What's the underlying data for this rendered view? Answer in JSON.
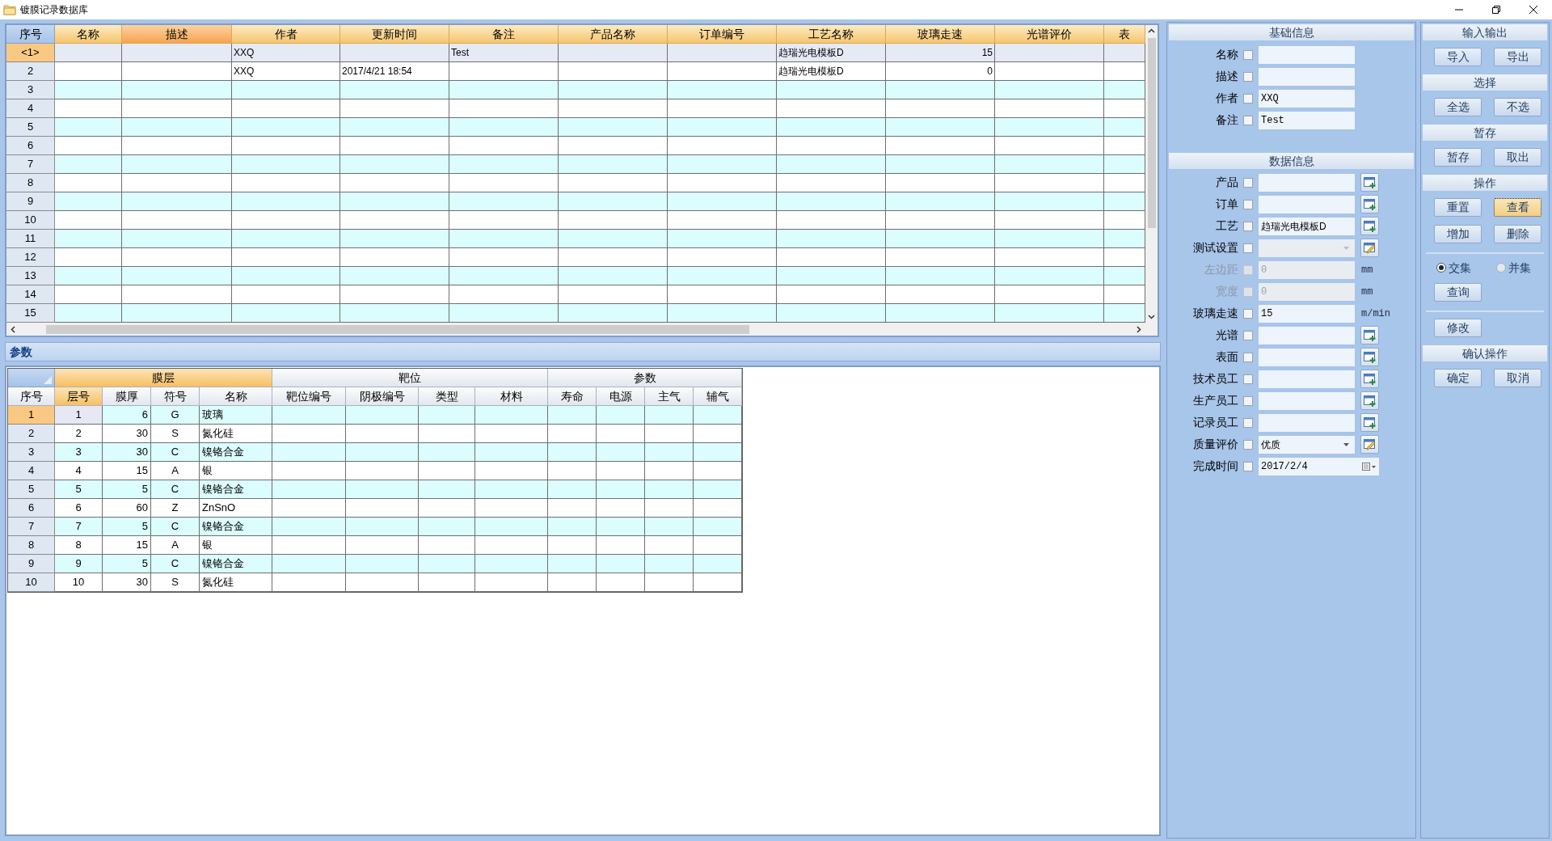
{
  "window": {
    "title": "镀膜记录数据库"
  },
  "top_table": {
    "index_label": "序号",
    "columns": [
      {
        "label": "名称",
        "selected": false,
        "kind": "text"
      },
      {
        "label": "描述",
        "selected": true,
        "kind": "text"
      },
      {
        "label": "作者",
        "selected": false,
        "kind": "text"
      },
      {
        "label": "更新时间",
        "selected": false,
        "kind": "text"
      },
      {
        "label": "备注",
        "selected": false,
        "kind": "text"
      },
      {
        "label": "产品名称",
        "selected": false,
        "kind": "text"
      },
      {
        "label": "订单编号",
        "selected": false,
        "kind": "text"
      },
      {
        "label": "工艺名称",
        "selected": false,
        "kind": "text"
      },
      {
        "label": "玻璃走速",
        "selected": false,
        "kind": "number"
      },
      {
        "label": "光谱评价",
        "selected": false,
        "kind": "text"
      },
      {
        "label": "表",
        "selected": false,
        "kind": "text"
      }
    ],
    "rows": [
      {
        "no": "<1>",
        "selected": true,
        "author": "XXQ",
        "remark": "Test",
        "process_name": "趋瑞光电模板D",
        "glass_speed": "15"
      },
      {
        "no": "2",
        "selected": false,
        "author": "XXQ",
        "updated": "2017/4/21 18:54",
        "process_name": "趋瑞光电模板D",
        "glass_speed": "0"
      },
      {
        "no": "3",
        "selected": false
      },
      {
        "no": "4",
        "selected": false
      },
      {
        "no": "5",
        "selected": false
      },
      {
        "no": "6",
        "selected": false
      },
      {
        "no": "7",
        "selected": false
      },
      {
        "no": "8",
        "selected": false
      },
      {
        "no": "9",
        "selected": false
      },
      {
        "no": "10",
        "selected": false
      },
      {
        "no": "11",
        "selected": false
      },
      {
        "no": "12",
        "selected": false
      },
      {
        "no": "13",
        "selected": false
      },
      {
        "no": "14",
        "selected": false
      },
      {
        "no": "15",
        "selected": false
      }
    ]
  },
  "params_panel": {
    "title": "参数"
  },
  "layer_table": {
    "index_label": "序号",
    "groups": [
      {
        "label": "膜层",
        "selected": true
      },
      {
        "label": "靶位",
        "selected": false
      },
      {
        "label": "参数",
        "selected": false
      }
    ],
    "columns": [
      {
        "label": "层号",
        "selected": true,
        "kind": "center"
      },
      {
        "label": "膜厚",
        "selected": false,
        "kind": "number"
      },
      {
        "label": "符号",
        "selected": false,
        "kind": "center"
      },
      {
        "label": "名称",
        "selected": false,
        "kind": "text"
      },
      {
        "label": "靶位编号",
        "selected": false,
        "kind": "text"
      },
      {
        "label": "阴极编号",
        "selected": false,
        "kind": "text"
      },
      {
        "label": "类型",
        "selected": false,
        "kind": "text"
      },
      {
        "label": "材料",
        "selected": false,
        "kind": "text"
      },
      {
        "label": "寿命",
        "selected": false,
        "kind": "text"
      },
      {
        "label": "电源",
        "selected": false,
        "kind": "text"
      },
      {
        "label": "主气",
        "selected": false,
        "kind": "text"
      },
      {
        "label": "辅气",
        "selected": false,
        "kind": "text"
      }
    ],
    "rows": [
      {
        "no": "1",
        "selected": true,
        "layer_no": "1",
        "thickness": "6",
        "symbol": "G",
        "name": "玻璃"
      },
      {
        "no": "2",
        "selected": false,
        "layer_no": "2",
        "thickness": "30",
        "symbol": "S",
        "name": "氮化硅"
      },
      {
        "no": "3",
        "selected": false,
        "layer_no": "3",
        "thickness": "30",
        "symbol": "C",
        "name": "镍铬合金"
      },
      {
        "no": "4",
        "selected": false,
        "layer_no": "4",
        "thickness": "15",
        "symbol": "A",
        "name": "银"
      },
      {
        "no": "5",
        "selected": false,
        "layer_no": "5",
        "thickness": "5",
        "symbol": "C",
        "name": "镍铬合金"
      },
      {
        "no": "6",
        "selected": false,
        "layer_no": "6",
        "thickness": "60",
        "symbol": "Z",
        "name": "ZnSnO"
      },
      {
        "no": "7",
        "selected": false,
        "layer_no": "7",
        "thickness": "5",
        "symbol": "C",
        "name": "镍铬合金"
      },
      {
        "no": "8",
        "selected": false,
        "layer_no": "8",
        "thickness": "15",
        "symbol": "A",
        "name": "银"
      },
      {
        "no": "9",
        "selected": false,
        "layer_no": "9",
        "thickness": "5",
        "symbol": "C",
        "name": "镍铬合金"
      },
      {
        "no": "10",
        "selected": false,
        "layer_no": "10",
        "thickness": "30",
        "symbol": "S",
        "name": "氮化硅"
      }
    ]
  },
  "basic_info": {
    "title": "基础信息",
    "fields": [
      {
        "label": "名称",
        "checked": false,
        "kind": "text"
      },
      {
        "label": "描述",
        "checked": false,
        "kind": "text"
      },
      {
        "label": "作者",
        "checked": false,
        "kind": "text",
        "value": "XXQ"
      },
      {
        "label": "备注",
        "checked": false,
        "kind": "text",
        "value": "Test"
      }
    ]
  },
  "data_info": {
    "title": "数据信息",
    "fields": [
      {
        "label": "产品",
        "checked": false,
        "kind": "text",
        "button": {
          "kind": "add"
        }
      },
      {
        "label": "订单",
        "checked": false,
        "kind": "text",
        "button": {
          "kind": "add"
        }
      },
      {
        "label": "工艺",
        "checked": false,
        "kind": "text",
        "value": "趋瑞光电模板D",
        "button": {
          "kind": "add"
        }
      },
      {
        "label": "测试设置",
        "checked": false,
        "kind": "combo",
        "input_disabled": true,
        "button": {
          "kind": "edit"
        }
      },
      {
        "label": "左边距",
        "checked": false,
        "kind": "text",
        "value": "0",
        "disabled": true,
        "unit": "mm"
      },
      {
        "label": "宽度",
        "checked": false,
        "kind": "text",
        "value": "0",
        "disabled": true,
        "unit": "mm"
      },
      {
        "label": "玻璃走速",
        "checked": false,
        "kind": "text",
        "value": "15",
        "unit": "m/min"
      },
      {
        "label": "光谱",
        "checked": false,
        "kind": "text",
        "button": {
          "kind": "add"
        }
      },
      {
        "label": "表面",
        "checked": false,
        "kind": "text",
        "button": {
          "kind": "add"
        }
      },
      {
        "label": "技术员工",
        "checked": false,
        "kind": "text",
        "button": {
          "kind": "add"
        }
      },
      {
        "label": "生产员工",
        "checked": false,
        "kind": "text",
        "button": {
          "kind": "add"
        }
      },
      {
        "label": "记录员工",
        "checked": false,
        "kind": "text",
        "button": {
          "kind": "add"
        }
      },
      {
        "label": "质量评价",
        "checked": false,
        "kind": "combo",
        "value": "优质",
        "button": {
          "kind": "edit"
        }
      },
      {
        "label": "完成时间",
        "checked": false,
        "kind": "date",
        "value": "2017/2/4"
      }
    ]
  },
  "operations": {
    "sections": [
      {
        "title": "输入输出",
        "rows": [
          {
            "kind": "buttons",
            "buttons": [
              {
                "label": "导入",
                "focused": false
              },
              {
                "label": "导出",
                "focused": false
              }
            ]
          }
        ]
      },
      {
        "title": "选择",
        "rows": [
          {
            "kind": "buttons",
            "buttons": [
              {
                "label": "全选",
                "focused": false
              },
              {
                "label": "不选",
                "focused": false
              }
            ]
          }
        ]
      },
      {
        "title": "暂存",
        "rows": [
          {
            "kind": "buttons",
            "buttons": [
              {
                "label": "暂存",
                "focused": false
              },
              {
                "label": "取出",
                "focused": false
              }
            ]
          }
        ]
      },
      {
        "title": "操作",
        "rows": [
          {
            "kind": "buttons",
            "buttons": [
              {
                "label": "重置",
                "focused": false
              },
              {
                "label": "查看",
                "focused": true
              }
            ]
          },
          {
            "kind": "buttons",
            "buttons": [
              {
                "label": "增加",
                "focused": false
              },
              {
                "label": "删除",
                "focused": false
              }
            ]
          },
          {
            "kind": "radios",
            "divider_above": true,
            "options": [
              {
                "label": "交集",
                "selected": true
              },
              {
                "label": "并集",
                "selected": false
              }
            ]
          },
          {
            "kind": "buttons",
            "buttons": [
              {
                "label": "查询",
                "focused": false
              }
            ]
          },
          {
            "kind": "buttons",
            "divider_above": true,
            "buttons": [
              {
                "label": "修改",
                "focused": false
              }
            ]
          }
        ]
      },
      {
        "title": "确认操作",
        "rows": [
          {
            "kind": "buttons",
            "buttons": [
              {
                "label": "确定",
                "focused": false
              },
              {
                "label": "取消",
                "focused": false
              }
            ]
          }
        ]
      }
    ]
  }
}
